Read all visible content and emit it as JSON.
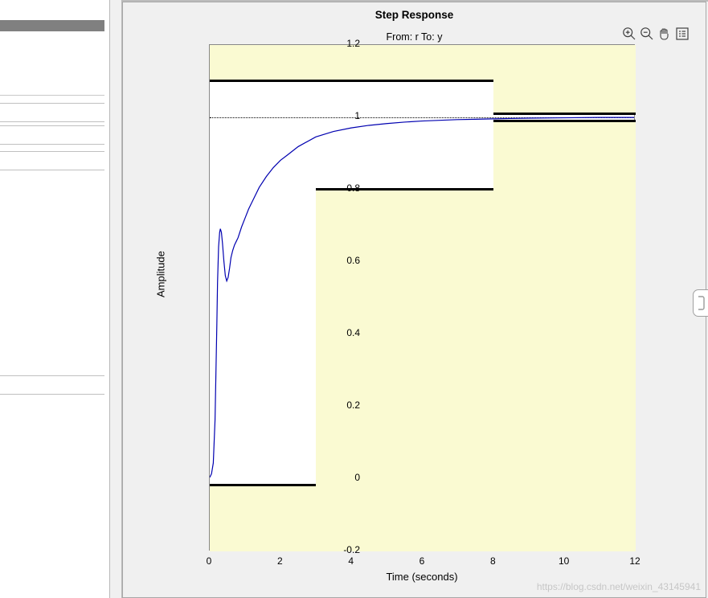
{
  "chart_data": {
    "type": "line",
    "title": "Step Response",
    "subtitle": "From: r  To: y",
    "xlabel": "Time (seconds)",
    "ylabel": "Amplitude",
    "xlim": [
      0,
      12
    ],
    "ylim": [
      -0.2,
      1.2
    ],
    "xticks": [
      0,
      2,
      4,
      6,
      8,
      10,
      12
    ],
    "yticks": [
      -0.2,
      0,
      0.2,
      0.4,
      0.6,
      0.8,
      1,
      1.2
    ],
    "steady_state": 1.0,
    "constraints": {
      "upper": {
        "amp": 1.1,
        "t_start": 0,
        "t_end": 8
      },
      "lower_rise": {
        "amp": -0.02,
        "t_start": 0,
        "t_end": 3
      },
      "lower_settle": {
        "amp": 0.8,
        "t_start": 3,
        "t_end": 8
      },
      "band_upper": {
        "amp": 1.01,
        "t_start": 8,
        "t_end": 12
      },
      "band_lower": {
        "amp": 0.99,
        "t_start": 8,
        "t_end": 12
      }
    },
    "series": [
      {
        "name": "y",
        "color": "#0000b0",
        "x": [
          0.0,
          0.05,
          0.1,
          0.15,
          0.2,
          0.22,
          0.25,
          0.28,
          0.3,
          0.33,
          0.36,
          0.4,
          0.44,
          0.48,
          0.52,
          0.56,
          0.6,
          0.65,
          0.7,
          0.75,
          0.8,
          0.9,
          1.0,
          1.1,
          1.2,
          1.4,
          1.6,
          1.8,
          2.0,
          2.2,
          2.5,
          3.0,
          3.5,
          4.0,
          4.5,
          5.0,
          5.5,
          6.0,
          6.5,
          7.0,
          7.5,
          8.0,
          8.5,
          9.0,
          10.0,
          11.0,
          12.0
        ],
        "y": [
          0.0,
          0.01,
          0.04,
          0.16,
          0.42,
          0.54,
          0.64,
          0.68,
          0.69,
          0.68,
          0.65,
          0.6,
          0.56,
          0.545,
          0.555,
          0.58,
          0.61,
          0.63,
          0.645,
          0.655,
          0.665,
          0.695,
          0.72,
          0.745,
          0.765,
          0.805,
          0.835,
          0.86,
          0.88,
          0.895,
          0.918,
          0.945,
          0.96,
          0.97,
          0.977,
          0.982,
          0.986,
          0.989,
          0.991,
          0.993,
          0.994,
          0.995,
          0.996,
          0.997,
          0.998,
          0.999,
          0.999
        ]
      }
    ]
  },
  "watermark": "https://blog.csdn.net/weixin_43145941"
}
